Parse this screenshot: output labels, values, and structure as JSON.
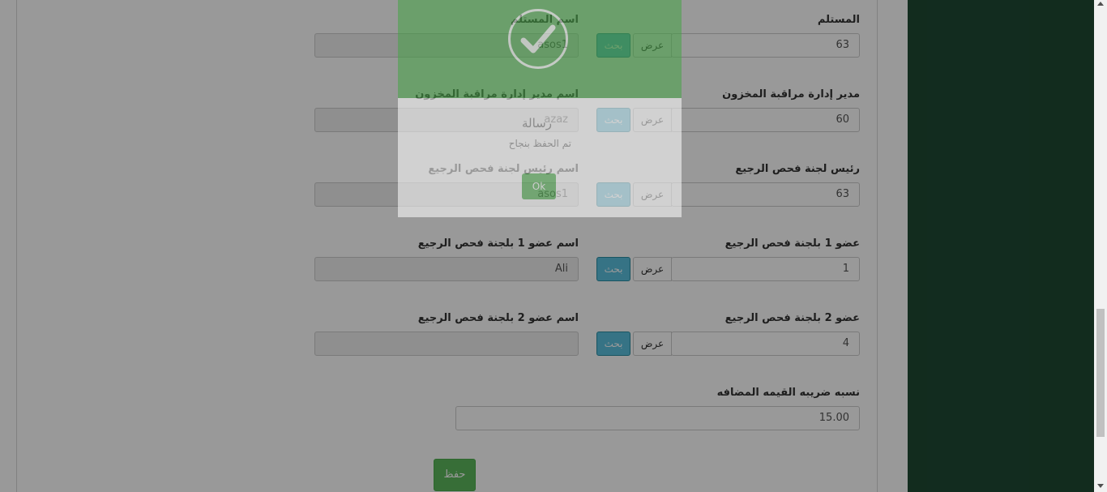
{
  "form": {
    "rows": [
      {
        "code_label": "المستلم",
        "code_value": "63",
        "name_label": "اسم المستلم",
        "name_value": "asos1"
      },
      {
        "code_label": "مدير إدارة مراقبة المخزون",
        "code_value": "60",
        "name_label": "اسم مدير إدارة مراقبة المخزون",
        "name_value": "azaz"
      },
      {
        "code_label": "رئيس لجنة فحص الرجيع",
        "code_value": "63",
        "name_label": "اسم رئيس لجنة فحص الرجيع",
        "name_value": "asos1"
      },
      {
        "code_label": "عضو 1 بلجنة فحص الرجيع",
        "code_value": "1",
        "name_label": "اسم عضو 1 بلجنة فحص الرجيع",
        "name_value": "Ali"
      },
      {
        "code_label": "عضو 2 بلجنة فحص الرجيع",
        "code_value": "4",
        "name_label": "اسم عضو 2 بلجنة فحص الرجيع",
        "name_value": ""
      }
    ],
    "view_label": "عرض",
    "search_label": "بحث",
    "vat_label": "نسبه ضريبه القيمه المضافه",
    "vat_value": "15.00",
    "save_label": "حفظ"
  },
  "modal": {
    "title": "رسالة",
    "message": "تم الحفظ بنجاح",
    "ok_label": "Ok"
  },
  "colors": {
    "sidebar": "#1e4a33",
    "search_button": "#5bc0de",
    "save_button": "#5cb85c",
    "modal_header": "#47a447"
  }
}
